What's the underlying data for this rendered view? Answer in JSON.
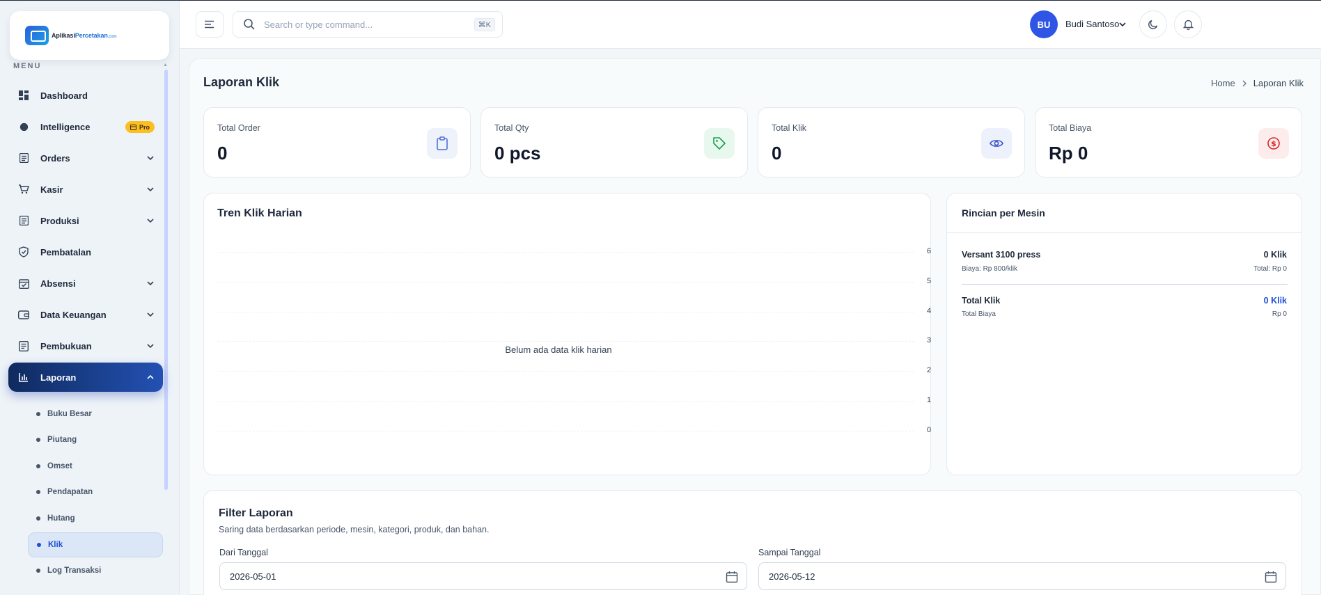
{
  "app": {
    "logo_main": "Aplikasi",
    "logo_accent": "Percetakan",
    "logo_suffix": ".com"
  },
  "sidebar": {
    "caption": "MENU",
    "items": [
      {
        "label": "Dashboard",
        "icon": "dashboard-icon"
      },
      {
        "label": "Intelligence",
        "icon": "brain-icon",
        "badge": "Pro"
      },
      {
        "label": "Orders",
        "icon": "list-icon"
      },
      {
        "label": "Kasir",
        "icon": "cart-icon"
      },
      {
        "label": "Produksi",
        "icon": "list-icon"
      },
      {
        "label": "Pembatalan",
        "icon": "shield-check-icon"
      },
      {
        "label": "Absensi",
        "icon": "calendar-check-icon"
      },
      {
        "label": "Data Keuangan",
        "icon": "wallet-icon"
      },
      {
        "label": "Pembukuan",
        "icon": "book-icon"
      },
      {
        "label": "Laporan",
        "icon": "bar-chart-icon"
      }
    ],
    "sub_items": [
      "Buku Besar",
      "Piutang",
      "Omset",
      "Pendapatan",
      "Hutang",
      "Klik",
      "Log Transaksi"
    ]
  },
  "topbar": {
    "search_placeholder": "Search or type command...",
    "shortcut": "⌘K",
    "avatar_initials": "BU",
    "user_name": "Budi Santoso"
  },
  "page": {
    "title": "Laporan Klik",
    "breadcrumb": [
      "Home",
      "Laporan Klik"
    ]
  },
  "stats": [
    {
      "label": "Total Order",
      "value": "0",
      "icon": "clipboard-icon",
      "color": "#4f6fd8",
      "bg": "#eef2fb"
    },
    {
      "label": "Total Qty",
      "value": "0 pcs",
      "icon": "tag-icon",
      "color": "#16a34a",
      "bg": "#e9f8ee"
    },
    {
      "label": "Total Klik",
      "value": "0",
      "icon": "eye-icon",
      "color": "#3b55c8",
      "bg": "#edf1fb"
    },
    {
      "label": "Total Biaya",
      "value": "Rp 0",
      "icon": "dollar-circle-icon",
      "color": "#dc2626",
      "bg": "#fdecec"
    }
  ],
  "chart": {
    "title": "Tren Klik Harian",
    "empty_message": "Belum ada data klik harian",
    "y_ticks": [
      "6",
      "5",
      "4",
      "3",
      "2",
      "1",
      "0"
    ]
  },
  "chart_data": {
    "type": "line",
    "title": "Tren Klik Harian",
    "x": [],
    "series": [],
    "ylim": [
      0,
      6
    ],
    "yticks": [
      0,
      1,
      2,
      3,
      4,
      5,
      6
    ],
    "grid": true
  },
  "rincian": {
    "title": "Rincian per Mesin",
    "machines": [
      {
        "name": "Versant 3100 press",
        "rate": "Biaya: Rp 800/klik",
        "klik": "0 Klik",
        "total": "Total: Rp 0"
      }
    ],
    "summary": {
      "label": "Total Klik",
      "sub_label": "Total Biaya",
      "klik": "0 Klik",
      "biaya": "Rp 0"
    }
  },
  "filter": {
    "title": "Filter Laporan",
    "description": "Saring data berdasarkan periode, mesin, kategori, produk, dan bahan.",
    "from_label": "Dari Tanggal",
    "from_value": "2026-05-01",
    "to_label": "Sampai Tanggal",
    "to_value": "2026-05-12"
  }
}
